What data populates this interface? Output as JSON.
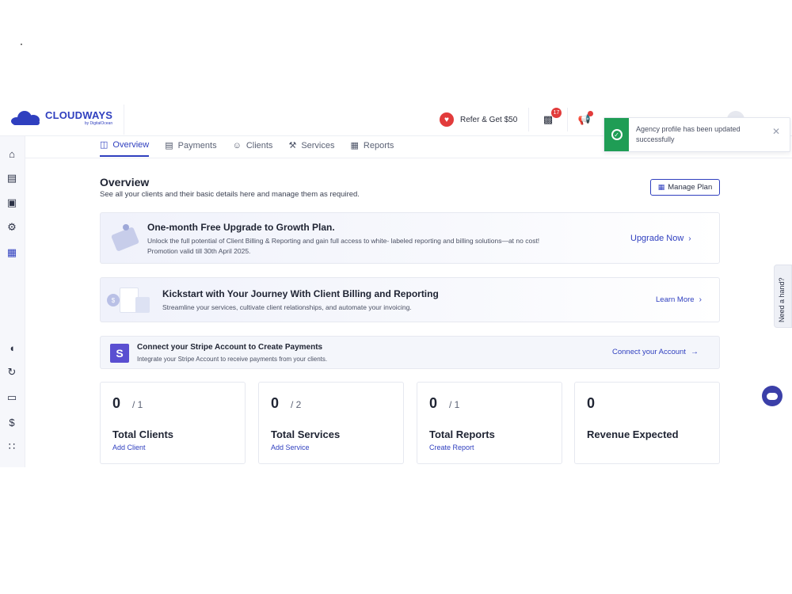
{
  "brand": {
    "name": "CLOUDWAYS",
    "sub": "by DigitalOcean"
  },
  "header": {
    "refer_label": "Refer & Get $50",
    "notifications_count": "17"
  },
  "toast": {
    "message": "Agency profile has been updated successfully",
    "status_color": "#1f9d55"
  },
  "tabs": [
    {
      "label": "Overview",
      "icon": "monitor-chart-icon",
      "active": true
    },
    {
      "label": "Payments",
      "icon": "document-icon"
    },
    {
      "label": "Clients",
      "icon": "users-icon"
    },
    {
      "label": "Services",
      "icon": "wrench-icon"
    },
    {
      "label": "Reports",
      "icon": "report-icon"
    }
  ],
  "overview": {
    "title": "Overview",
    "subtitle": "See all your clients and their basic details here and manage them as required.",
    "manage_plan": "Manage Plan"
  },
  "banners": {
    "upgrade": {
      "title": "One-month Free Upgrade to Growth Plan.",
      "text1": "Unlock the full potential of Client Billing & Reporting and gain full access to white- labeled reporting and billing solutions—at no cost!",
      "text2": "Promotion valid till 30th April 2025.",
      "link": "Upgrade Now"
    },
    "kickstart": {
      "title": "Kickstart with Your Journey With Client Billing and Reporting",
      "text": "Streamline your services, cultivate client relationships, and automate your invoicing.",
      "link": "Learn More"
    },
    "stripe": {
      "title": "Connect your Stripe Account to Create Payments",
      "text": "Integrate your Stripe Account to receive payments from your clients.",
      "link": "Connect your Account",
      "logo_letter": "S"
    }
  },
  "cards": [
    {
      "count": "0",
      "total": "/ 1",
      "label": "Total Clients",
      "link": "Add Client"
    },
    {
      "count": "0",
      "total": "/ 2",
      "label": "Total Services",
      "link": "Add Service"
    },
    {
      "count": "0",
      "total": "/ 1",
      "label": "Total Reports",
      "link": "Create Report"
    },
    {
      "count": "0",
      "total": "",
      "label": "Revenue Expected",
      "link": ""
    }
  ],
  "help": {
    "need_hand": "Need a hand?"
  },
  "colors": {
    "accent": "#2f3fbf",
    "danger": "#e23b3b",
    "success": "#1f9d55"
  }
}
